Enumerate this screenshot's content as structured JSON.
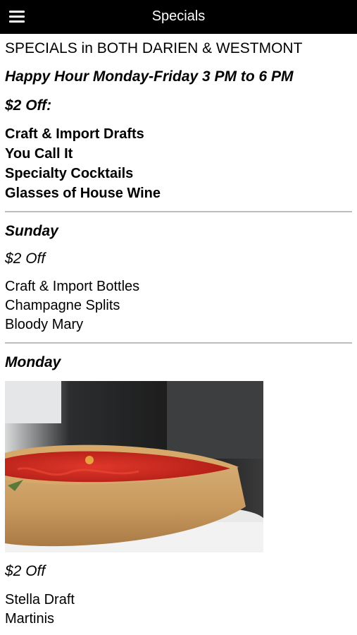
{
  "header": {
    "title": "Specials",
    "menu_icon": "hamburger-menu-icon"
  },
  "intro": {
    "locations": "SPECIALS in BOTH DARIEN & WESTMONT",
    "happy_hour": "Happy Hour Monday-Friday  3 PM to 6 PM",
    "discount": "$2 Off:",
    "items": [
      "Craft & Import Drafts",
      "You Call It",
      "Specialty Cocktails",
      "Glasses of House Wine"
    ]
  },
  "sunday": {
    "day": "Sunday",
    "discount": "$2 Off",
    "items": [
      "Craft & Import Bottles",
      "Champagne Splits",
      "Bloody Mary"
    ]
  },
  "monday": {
    "day": "Monday",
    "image": "deep-dish-pizza-photo",
    "discount": "$2 Off",
    "items": [
      "Stella Draft",
      "Martinis"
    ]
  },
  "colors": {
    "header_bg": "#000000",
    "header_text": "#ffffff",
    "divider": "#bdbdbd",
    "sauce": "#c8261d"
  }
}
